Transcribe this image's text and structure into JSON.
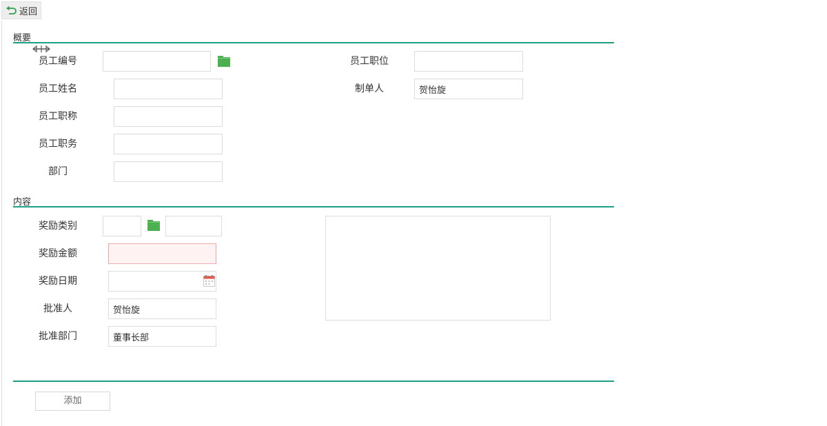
{
  "toolbar": {
    "back_label": "返回"
  },
  "sections": {
    "overview_title": "概要",
    "content_title": "内容"
  },
  "overview": {
    "employee_no_label": "员工编号",
    "employee_no_value": "",
    "employee_name_label": "员工姓名",
    "employee_name_value": "",
    "employee_title_label": "员工职称",
    "employee_title_value": "",
    "employee_duty_label": "员工职务",
    "employee_duty_value": "",
    "department_label": "部门",
    "department_value": "",
    "employee_position_label": "员工职位",
    "employee_position_value": "",
    "creator_label": "制单人",
    "creator_value": "贺怡旋"
  },
  "content": {
    "reward_type_label": "奖励类别",
    "reward_type_code": "",
    "reward_type_name": "",
    "reward_amount_label": "奖励金额",
    "reward_amount_value": "",
    "reward_date_label": "奖励日期",
    "reward_date_value": "",
    "approver_label": "批准人",
    "approver_value": "贺怡旋",
    "approve_dept_label": "批准部门",
    "approve_dept_value": "董事长部",
    "remarks_value": ""
  },
  "actions": {
    "add_label": "添加"
  },
  "colors": {
    "accent_line": "#1c9f84",
    "folder_icon": "#4caf50",
    "error_border": "#f3a8a8",
    "error_fill": "#fff2f2"
  },
  "icons": {
    "back": "back-arrow-icon",
    "folder": "folder-icon",
    "calendar": "calendar-icon",
    "resize": "column-resize-icon"
  }
}
